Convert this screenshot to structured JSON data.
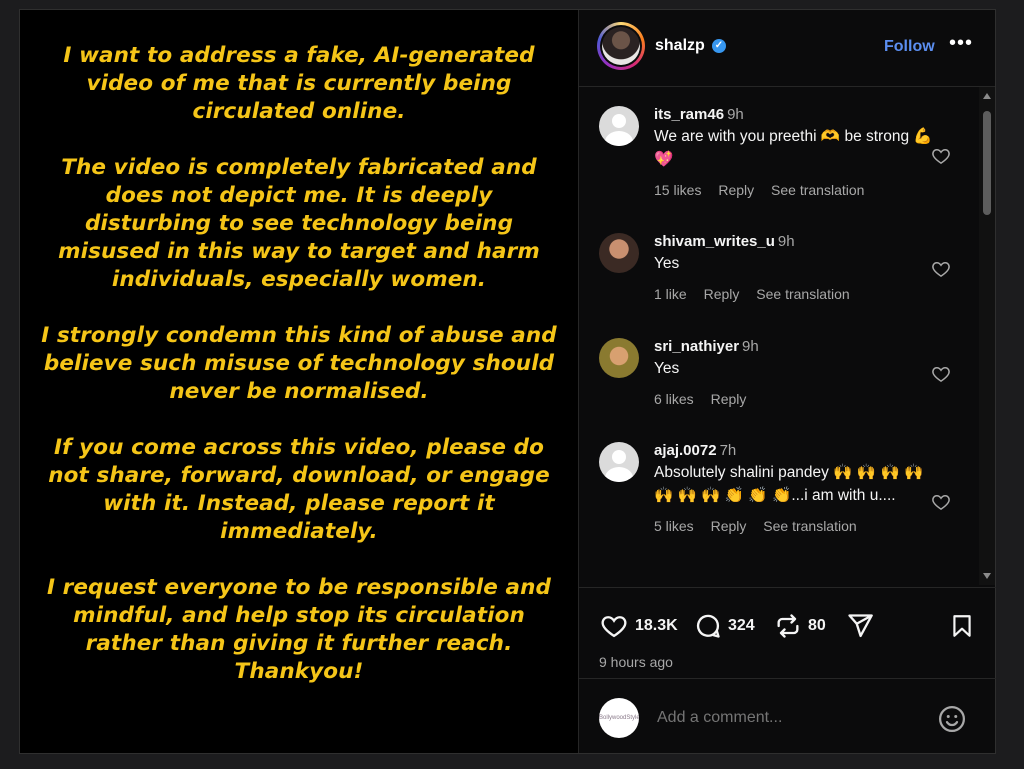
{
  "story": {
    "paragraphs": [
      "I want to address a fake, AI-generated video of me that is currently being circulated online.",
      "The video is completely fabricated and does not depict me. It is deeply disturbing to see technology being misused in this way to target and harm individuals, especially women.",
      "I strongly condemn this kind of abuse and believe such misuse of technology should never be normalised.",
      "If you come across this video, please do not share, forward, download, or engage with it. Instead, please report it immediately.",
      "I request everyone to be responsible and mindful, and help stop its circulation rather than giving it further reach."
    ],
    "signoff": "Thankyou!"
  },
  "header": {
    "username": "shalzp",
    "verified_mark": "✓",
    "follow_label": "Follow",
    "more_label": "•••"
  },
  "comments": [
    {
      "user": "its_ram46",
      "time": "9h",
      "text": "We are with you preethi 🫶 be strong 💪 💖",
      "likes": "15 likes",
      "reply": "Reply",
      "translate": "See translation"
    },
    {
      "user": "shivam_writes_u",
      "time": "9h",
      "text": "Yes",
      "likes": "1 like",
      "reply": "Reply",
      "translate": "See translation"
    },
    {
      "user": "sri_nathiyer",
      "time": "9h",
      "text": "Yes",
      "likes": "6 likes",
      "reply": "Reply",
      "translate": ""
    },
    {
      "user": "ajaj.0072",
      "time": "7h",
      "text": "Absolutely shalini pandey 🙌 🙌 🙌 🙌 🙌 🙌 🙌 👏 👏 👏...i am with u....",
      "likes": "5 likes",
      "reply": "Reply",
      "translate": "See translation"
    }
  ],
  "actions": {
    "likes": "18.3K",
    "comments": "324",
    "reposts": "80",
    "posted_ago": "9 hours ago"
  },
  "add_comment": {
    "placeholder": "Add a comment...",
    "avatar_text": "BollywoodStyle"
  },
  "colors": {
    "story_text": "#f5c518",
    "follow": "#5b8ef0",
    "verified": "#3797f0"
  }
}
